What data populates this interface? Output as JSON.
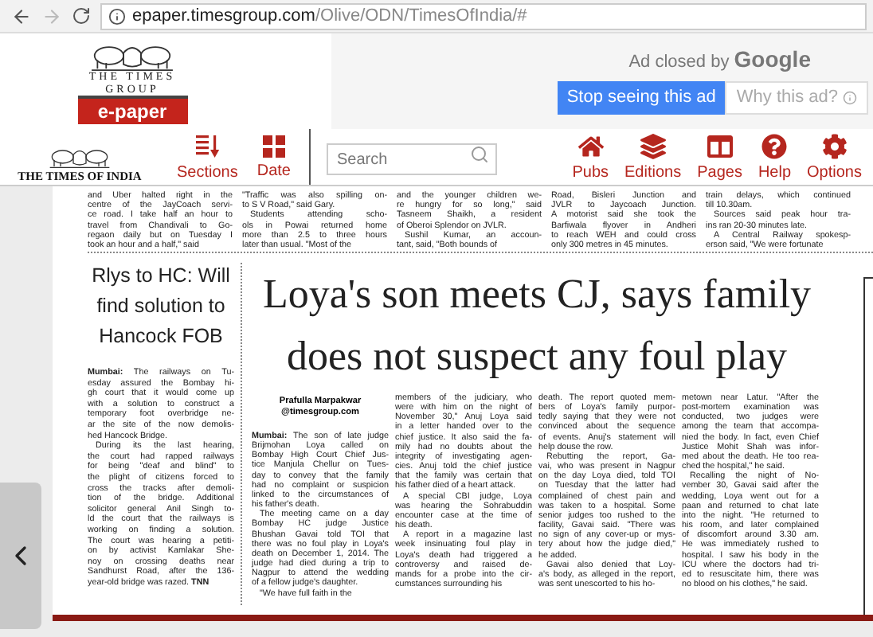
{
  "browser": {
    "url_host": "epaper.timesgroup.com",
    "url_path": "/Olive/ODN/TimesOfIndia/#"
  },
  "header": {
    "logo": {
      "line1": "THE TIMES",
      "line2": "GROUP",
      "badge": "e-paper"
    },
    "ad": {
      "notice": "Ad closed by",
      "brand": "Google",
      "stop_button": "Stop seeing this ad",
      "why_button": "Why this ad?"
    }
  },
  "toolbar": {
    "masthead": "THE TIMES OF INDIA",
    "left_tools": [
      {
        "kind": "sections",
        "label": "Sections"
      },
      {
        "kind": "date",
        "label": "Date"
      }
    ],
    "search": {
      "placeholder": "Search"
    },
    "right_tools": [
      {
        "kind": "pubs",
        "label": "Pubs"
      },
      {
        "kind": "editions",
        "label": "Editions"
      },
      {
        "kind": "pages",
        "label": "Pages"
      },
      {
        "kind": "help",
        "label": "Help"
      },
      {
        "kind": "options",
        "label": "Options"
      }
    ]
  },
  "page": {
    "top_columns": [
      {
        "paragraphs": [
          {
            "indent": false,
            "lines": [
              "and Uber halted right in the",
              "centre of the JayCoach servi-",
              "ce road. I take half an hour to",
              "travel from Chandivali to Go-",
              "regaon daily but on Tuesday I",
              "took an hour and a half,\" said"
            ]
          }
        ]
      },
      {
        "paragraphs": [
          {
            "indent": false,
            "lines": [
              "\"Traffic was also spilling on-",
              "to S V Road,\" said Gary."
            ]
          },
          {
            "indent": true,
            "lines": [
              "Students attending scho-",
              "ols in Powai returned home",
              "more than 2.5 to three hours",
              "later than usual. \"Most of the"
            ]
          }
        ]
      },
      {
        "paragraphs": [
          {
            "indent": false,
            "lines": [
              "and the younger children we-",
              "re hungry for so long,\" said",
              "Tasneem Shaikh, a resident",
              "of Oberoi Splendor on JVLR."
            ]
          },
          {
            "indent": true,
            "lines": [
              "Sushil Kumar, an accoun-",
              "tant, said, \"Both bounds of"
            ]
          }
        ]
      },
      {
        "paragraphs": [
          {
            "indent": false,
            "lines": [
              "Road, Bisleri Junction and",
              "JVLR to Jaycoach Junction.",
              "A motorist said she took the",
              "Barfiwala flyover in Andheri",
              "to reach WEH and could cross",
              "only 300 metres in 45 minutes."
            ]
          }
        ]
      },
      {
        "paragraphs": [
          {
            "indent": false,
            "lines": [
              "train delays, which continued",
              "till 10.30am."
            ]
          },
          {
            "indent": true,
            "lines": [
              "Sources said peak hour tra-",
              "ins ran 20-30 minutes late."
            ]
          },
          {
            "indent": true,
            "lines": [
              "A Central Railway spokesp-",
              "erson said, \"We were fortunate"
            ]
          }
        ]
      }
    ],
    "side_story": {
      "headline": [
        "Rlys to HC: Will",
        "find solution to",
        "Hancock FOB"
      ],
      "paragraphs": [
        {
          "indent": false,
          "lines": [
            "**Mumbai:** The railways on Tu-",
            "esday assured the Bombay hi-",
            "gh court that it would come up",
            "with a solution to construct a",
            "temporary foot overbridge ne-",
            "ar the site of the now demolis-",
            "hed Hancock Bridge."
          ]
        },
        {
          "indent": true,
          "lines": [
            "During its the last hearing,",
            "the court had rapped railways",
            "for being \"deaf and blind\" to",
            "the plight of citizens forced to",
            "cross the tracks after demoli-",
            "tion of the bridge. Additional",
            "solicitor general Anil Singh to-",
            "ld the court that the railways is",
            "working on finding a solution.",
            "The court was hearing a petiti-",
            "on by activist Kamlakar She-",
            "noy on crossing deaths near",
            "Sandhurst Road, after the 136-",
            "year-old bridge was razed. **TNN**"
          ]
        }
      ]
    },
    "main_story": {
      "headline": [
        "Loya's son meets CJ, says family",
        "does not suspect any foul play"
      ],
      "byline": {
        "name": "Prafulla Marpakwar",
        "email": "@timesgroup.com"
      },
      "columns": [
        {
          "paragraphs": [
            {
              "indent": false,
              "lines": [
                "**Mumbai:** The son of late judge",
                "Brijmohan Loya called on",
                "Bombay High Court Chief Jus-",
                "tice Manjula Chellur on Tues-",
                "day to convey that the family",
                "had no complaint or suspicion",
                "linked to the circumstances of",
                "his father's death."
              ]
            },
            {
              "indent": true,
              "lines": [
                "The meeting came on a day",
                "Bombay HC judge Justice",
                "Bhushan Gavai told TOI that",
                "there was no foul play in Loya's",
                "death on December 1, 2014. The",
                "judge had died during a trip to",
                "Nagpur to attend the wedding",
                "of a fellow judge's daughter."
              ]
            },
            {
              "indent": true,
              "lines": [
                "\"We have full faith in the"
              ]
            }
          ]
        },
        {
          "paragraphs": [
            {
              "indent": false,
              "lines": [
                "members of the judiciary, who",
                "were with him on the night of",
                "November 30,\" Anuj Loya said",
                "in a letter handed over to the",
                "chief justice. It also said the fa-",
                "mily had no doubts about the",
                "integrity of investigating agen-",
                "cies. Anuj told the chief justice",
                "that the family was certain that",
                "his father died of a heart attack."
              ]
            },
            {
              "indent": true,
              "lines": [
                "A special CBI judge, Loya",
                "was hearing the Sohrabuddin",
                "encounter case at the time of",
                "his death."
              ]
            },
            {
              "indent": true,
              "lines": [
                "A report in a magazine last",
                "week insinuating foul play in",
                "Loya's death had triggered a",
                "controversy and raised de-",
                "mands for a probe into the cir-",
                "cumstances surrounding his"
              ]
            }
          ]
        },
        {
          "paragraphs": [
            {
              "indent": false,
              "lines": [
                "death. The report quoted mem-",
                "bers of Loya's family purpor-",
                "tedly saying that they were not",
                "convinced about the sequence",
                "of events. Anuj's statement will",
                "help douse the row."
              ]
            },
            {
              "indent": true,
              "lines": [
                "Rebutting the report, Ga-",
                "vai, who was present in Nagpur",
                "on the day Loya died, told TOI",
                "on Tuesday that the latter had",
                "complained of chest pain and",
                "was taken to a hospital. Some",
                "senior judges too rushed to the",
                "facility, Gavai said. \"There was",
                "no sign of any cover-up or mys-",
                "tery about how the judge died,\"",
                "he added."
              ]
            },
            {
              "indent": true,
              "lines": [
                "Gavai also denied that Loy-",
                "a's body, as alleged in the report,",
                "was sent unescorted to his ho-"
              ]
            }
          ]
        },
        {
          "paragraphs": [
            {
              "indent": false,
              "lines": [
                "metown near Latur. \"After the",
                "post-mortem examination was",
                "conducted, two judges were",
                "among the team that accompa-",
                "nied the body. In fact, even Chief",
                "Justice Mohit Shah was infor-",
                "med about the death. He too rea-",
                "ched the hospital,\" he said."
              ]
            },
            {
              "indent": true,
              "lines": [
                "Recalling the night of No-",
                "vember 30, Gavai said after the",
                "wedding, Loya went out for a",
                "paan and returned to chat late",
                "into the night. \"He returned to",
                "his room, and later complained",
                "of discomfort around 3.30 am.",
                "He was immediately rushed to",
                "hospital. I saw his body in the",
                "ICU where the doctors had tri-",
                "ed to resuscitate him, there was",
                "no blood on his clothes,\" he said."
              ]
            }
          ]
        }
      ]
    }
  }
}
